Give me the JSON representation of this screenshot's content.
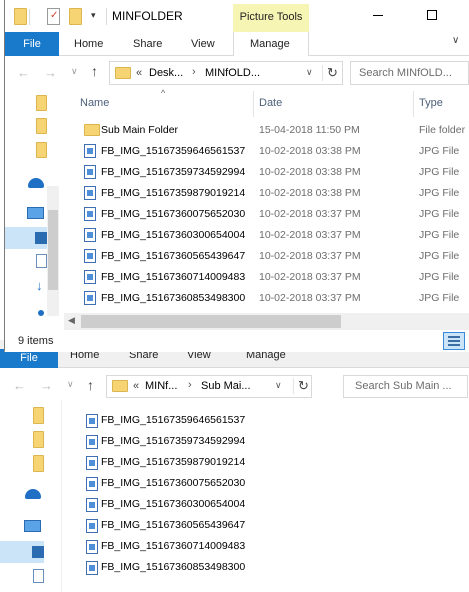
{
  "foreground": {
    "title": "MINFOLDER",
    "contextual_group": "Picture Tools",
    "ribbon_tabs": [
      "File",
      "Home",
      "Share",
      "View",
      "Manage"
    ],
    "address": {
      "prefix": "«",
      "parts": [
        "Desk...",
        "MINfOLD..."
      ]
    },
    "search_placeholder": "Search MINfOLD...",
    "columns": {
      "name": "Name",
      "date": "Date",
      "type": "Type"
    },
    "rows": [
      {
        "name": "Sub Main Folder",
        "date": "15-04-2018 11:50 PM",
        "type": "File folder",
        "icon": "folder-icon"
      },
      {
        "name": "FB_IMG_15167359646561537",
        "date": "10-02-2018 03:38 PM",
        "type": "JPG File",
        "icon": "jpg-file-icon"
      },
      {
        "name": "FB_IMG_15167359734592994",
        "date": "10-02-2018 03:38 PM",
        "type": "JPG File",
        "icon": "jpg-file-icon"
      },
      {
        "name": "FB_IMG_15167359879019214",
        "date": "10-02-2018 03:38 PM",
        "type": "JPG File",
        "icon": "jpg-file-icon"
      },
      {
        "name": "FB_IMG_15167360075652030",
        "date": "10-02-2018 03:37 PM",
        "type": "JPG File",
        "icon": "jpg-file-icon"
      },
      {
        "name": "FB_IMG_15167360300654004",
        "date": "10-02-2018 03:37 PM",
        "type": "JPG File",
        "icon": "jpg-file-icon"
      },
      {
        "name": "FB_IMG_15167360565439647",
        "date": "10-02-2018 03:37 PM",
        "type": "JPG File",
        "icon": "jpg-file-icon"
      },
      {
        "name": "FB_IMG_15167360714009483",
        "date": "10-02-2018 03:37 PM",
        "type": "JPG File",
        "icon": "jpg-file-icon"
      },
      {
        "name": "FB_IMG_15167360853498300",
        "date": "10-02-2018 03:37 PM",
        "type": "JPG File",
        "icon": "jpg-file-icon"
      }
    ],
    "status_text": "9 items"
  },
  "background": {
    "ribbon_tabs": [
      "File",
      "Home",
      "Share",
      "View",
      "Manage"
    ],
    "address": {
      "prefix": "«",
      "parts": [
        "MINf...",
        "Sub Mai..."
      ]
    },
    "search_placeholder": "Search Sub Main ...",
    "files": [
      "FB_IMG_15167359646561537",
      "FB_IMG_15167359734592994",
      "FB_IMG_15167359879019214",
      "FB_IMG_15167360075652030",
      "FB_IMG_15167360300654004",
      "FB_IMG_15167360565439647",
      "FB_IMG_15167360714009483",
      "FB_IMG_15167360853498300"
    ]
  },
  "colors": {
    "accent": "#1979ca",
    "contextual": "#f7f5b4",
    "folder": "#f7d473"
  }
}
